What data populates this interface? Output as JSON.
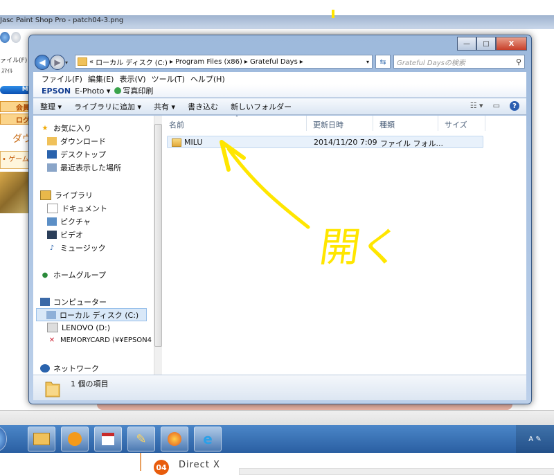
{
  "background_app": {
    "title": "Jasc Paint Shop Pro - patch04-3.png",
    "menu_fragment": "ァイル(F)",
    "side_labels": [
      "会員",
      "ログ",
      "ダウ",
      "ゲーム"
    ],
    "logo_fragment": "MI",
    "strip_label": "ｽﾏｲﾙ"
  },
  "window": {
    "controls": {
      "minimize": "—",
      "maximize": "□",
      "close": "X"
    },
    "breadcrumb": [
      "«",
      "ローカル ディスク (C:)",
      "Program Files (x86)",
      "Grateful Days"
    ],
    "search_placeholder": "Grateful Daysの検索",
    "menu": [
      "ファイル(F)",
      "編集(E)",
      "表示(V)",
      "ツール(T)",
      "ヘルプ(H)"
    ],
    "epson": {
      "logo": "EPSON",
      "ephoto": "E-Photo",
      "print": "写真印刷"
    },
    "toolbar": [
      "整理 ▾",
      "ライブラリに追加 ▾",
      "共有 ▾",
      "書き込む",
      "新しいフォルダー"
    ],
    "nav_pane": {
      "favorites": {
        "label": "お気に入り",
        "items": [
          "ダウンロード",
          "デスクトップ",
          "最近表示した場所"
        ]
      },
      "libraries": {
        "label": "ライブラリ",
        "items": [
          "ドキュメント",
          "ピクチャ",
          "ビデオ",
          "ミュージック"
        ]
      },
      "homegroup": "ホームグループ",
      "computer": {
        "label": "コンピューター",
        "items": [
          "ローカル ディスク (C:)",
          "LENOVO (D:)",
          "MEMORYCARD (¥¥EPSON4"
        ]
      },
      "network": "ネットワーク"
    },
    "columns": [
      "名前",
      "更新日時",
      "種類",
      "サイズ"
    ],
    "files": [
      {
        "name": "MILU",
        "modified": "2014/11/20 7:09",
        "type": "ファイル フォル..."
      }
    ],
    "status": "1 個の項目"
  },
  "annotation": {
    "text": "開く",
    "color": "#ffe600"
  },
  "bottom_page": {
    "badge": "04",
    "label": "Direct X"
  },
  "colors": {
    "taskbar": "#2a5fa2",
    "accent": "#e85c0c"
  }
}
